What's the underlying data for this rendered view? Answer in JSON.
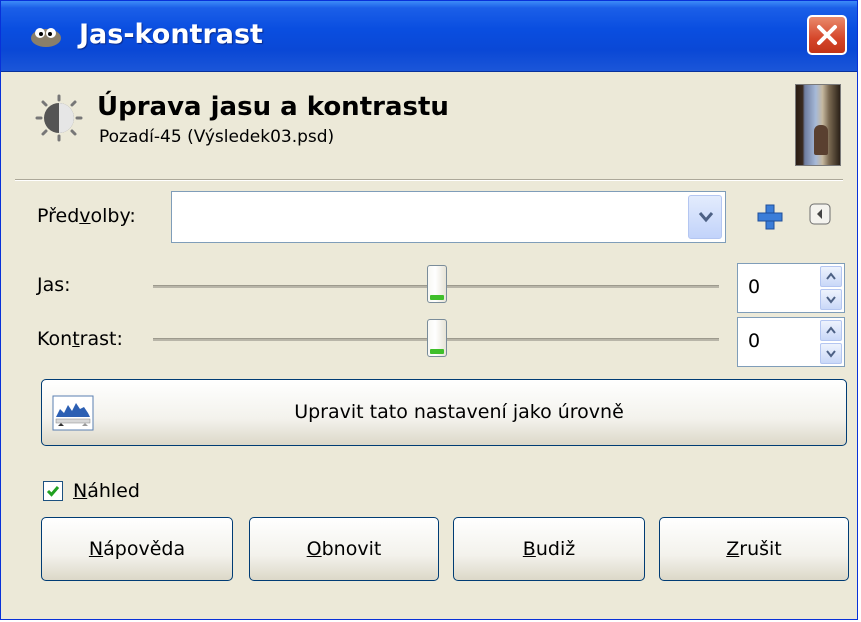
{
  "window": {
    "title": "Jas-kontrast"
  },
  "header": {
    "title": "Úprava jasu a kontrastu",
    "subtitle": "Pozadí-45 (Výsledek03.psd)"
  },
  "presets": {
    "label_before": "Před",
    "label_underline": "v",
    "label_after": "olby:",
    "value": ""
  },
  "brightness": {
    "label_underline": "J",
    "label_after": "as:",
    "value": "0"
  },
  "contrast": {
    "label_before": "Kon",
    "label_underline": "t",
    "label_after": "rast:",
    "value": "0"
  },
  "levels_button": {
    "label": "Upravit tato nastavení jako úrovně"
  },
  "preview": {
    "label_underline": "N",
    "label_after": "áhled",
    "checked": true
  },
  "buttons": {
    "help": {
      "underline": "N",
      "rest": "ápověda"
    },
    "reset": {
      "underline": "O",
      "rest": "bnovit"
    },
    "ok": {
      "underline": "B",
      "rest": "udiž"
    },
    "cancel": {
      "underline": "Z",
      "rest": "rušit"
    }
  },
  "icons": {
    "app": "gimp-icon",
    "header": "brightness-contrast-icon",
    "add": "plus-icon",
    "menu": "menu-icon",
    "levels": "levels-icon",
    "close": "close-icon"
  },
  "colors": {
    "titlebar": "#0a4ee0",
    "dialog_bg": "#ece9d8",
    "close_btn": "#d5462a"
  }
}
